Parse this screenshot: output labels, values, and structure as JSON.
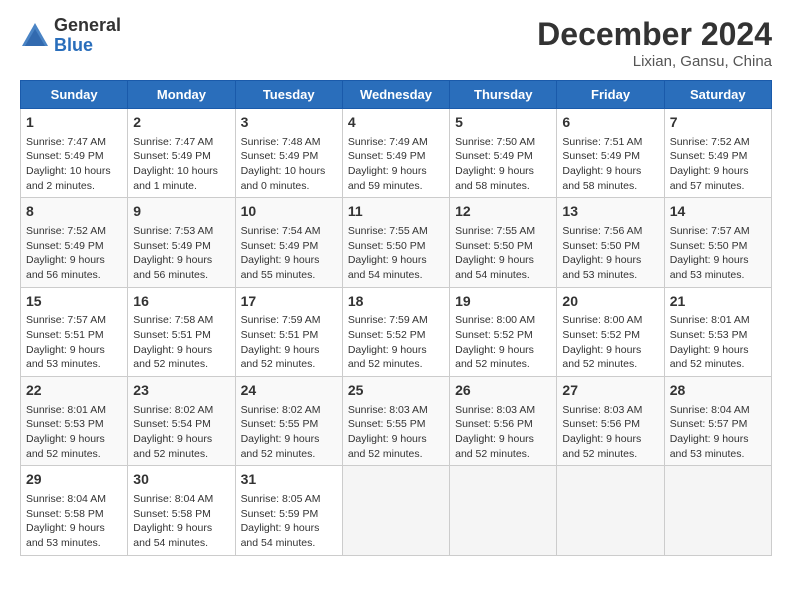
{
  "logo": {
    "general": "General",
    "blue": "Blue"
  },
  "header": {
    "title": "December 2024",
    "subtitle": "Lixian, Gansu, China"
  },
  "columns": [
    "Sunday",
    "Monday",
    "Tuesday",
    "Wednesday",
    "Thursday",
    "Friday",
    "Saturday"
  ],
  "weeks": [
    [
      {
        "day": "1",
        "sunrise": "Sunrise: 7:47 AM",
        "sunset": "Sunset: 5:49 PM",
        "daylight": "Daylight: 10 hours and 2 minutes."
      },
      {
        "day": "2",
        "sunrise": "Sunrise: 7:47 AM",
        "sunset": "Sunset: 5:49 PM",
        "daylight": "Daylight: 10 hours and 1 minute."
      },
      {
        "day": "3",
        "sunrise": "Sunrise: 7:48 AM",
        "sunset": "Sunset: 5:49 PM",
        "daylight": "Daylight: 10 hours and 0 minutes."
      },
      {
        "day": "4",
        "sunrise": "Sunrise: 7:49 AM",
        "sunset": "Sunset: 5:49 PM",
        "daylight": "Daylight: 9 hours and 59 minutes."
      },
      {
        "day": "5",
        "sunrise": "Sunrise: 7:50 AM",
        "sunset": "Sunset: 5:49 PM",
        "daylight": "Daylight: 9 hours and 58 minutes."
      },
      {
        "day": "6",
        "sunrise": "Sunrise: 7:51 AM",
        "sunset": "Sunset: 5:49 PM",
        "daylight": "Daylight: 9 hours and 58 minutes."
      },
      {
        "day": "7",
        "sunrise": "Sunrise: 7:52 AM",
        "sunset": "Sunset: 5:49 PM",
        "daylight": "Daylight: 9 hours and 57 minutes."
      }
    ],
    [
      {
        "day": "8",
        "sunrise": "Sunrise: 7:52 AM",
        "sunset": "Sunset: 5:49 PM",
        "daylight": "Daylight: 9 hours and 56 minutes."
      },
      {
        "day": "9",
        "sunrise": "Sunrise: 7:53 AM",
        "sunset": "Sunset: 5:49 PM",
        "daylight": "Daylight: 9 hours and 56 minutes."
      },
      {
        "day": "10",
        "sunrise": "Sunrise: 7:54 AM",
        "sunset": "Sunset: 5:49 PM",
        "daylight": "Daylight: 9 hours and 55 minutes."
      },
      {
        "day": "11",
        "sunrise": "Sunrise: 7:55 AM",
        "sunset": "Sunset: 5:50 PM",
        "daylight": "Daylight: 9 hours and 54 minutes."
      },
      {
        "day": "12",
        "sunrise": "Sunrise: 7:55 AM",
        "sunset": "Sunset: 5:50 PM",
        "daylight": "Daylight: 9 hours and 54 minutes."
      },
      {
        "day": "13",
        "sunrise": "Sunrise: 7:56 AM",
        "sunset": "Sunset: 5:50 PM",
        "daylight": "Daylight: 9 hours and 53 minutes."
      },
      {
        "day": "14",
        "sunrise": "Sunrise: 7:57 AM",
        "sunset": "Sunset: 5:50 PM",
        "daylight": "Daylight: 9 hours and 53 minutes."
      }
    ],
    [
      {
        "day": "15",
        "sunrise": "Sunrise: 7:57 AM",
        "sunset": "Sunset: 5:51 PM",
        "daylight": "Daylight: 9 hours and 53 minutes."
      },
      {
        "day": "16",
        "sunrise": "Sunrise: 7:58 AM",
        "sunset": "Sunset: 5:51 PM",
        "daylight": "Daylight: 9 hours and 52 minutes."
      },
      {
        "day": "17",
        "sunrise": "Sunrise: 7:59 AM",
        "sunset": "Sunset: 5:51 PM",
        "daylight": "Daylight: 9 hours and 52 minutes."
      },
      {
        "day": "18",
        "sunrise": "Sunrise: 7:59 AM",
        "sunset": "Sunset: 5:52 PM",
        "daylight": "Daylight: 9 hours and 52 minutes."
      },
      {
        "day": "19",
        "sunrise": "Sunrise: 8:00 AM",
        "sunset": "Sunset: 5:52 PM",
        "daylight": "Daylight: 9 hours and 52 minutes."
      },
      {
        "day": "20",
        "sunrise": "Sunrise: 8:00 AM",
        "sunset": "Sunset: 5:52 PM",
        "daylight": "Daylight: 9 hours and 52 minutes."
      },
      {
        "day": "21",
        "sunrise": "Sunrise: 8:01 AM",
        "sunset": "Sunset: 5:53 PM",
        "daylight": "Daylight: 9 hours and 52 minutes."
      }
    ],
    [
      {
        "day": "22",
        "sunrise": "Sunrise: 8:01 AM",
        "sunset": "Sunset: 5:53 PM",
        "daylight": "Daylight: 9 hours and 52 minutes."
      },
      {
        "day": "23",
        "sunrise": "Sunrise: 8:02 AM",
        "sunset": "Sunset: 5:54 PM",
        "daylight": "Daylight: 9 hours and 52 minutes."
      },
      {
        "day": "24",
        "sunrise": "Sunrise: 8:02 AM",
        "sunset": "Sunset: 5:55 PM",
        "daylight": "Daylight: 9 hours and 52 minutes."
      },
      {
        "day": "25",
        "sunrise": "Sunrise: 8:03 AM",
        "sunset": "Sunset: 5:55 PM",
        "daylight": "Daylight: 9 hours and 52 minutes."
      },
      {
        "day": "26",
        "sunrise": "Sunrise: 8:03 AM",
        "sunset": "Sunset: 5:56 PM",
        "daylight": "Daylight: 9 hours and 52 minutes."
      },
      {
        "day": "27",
        "sunrise": "Sunrise: 8:03 AM",
        "sunset": "Sunset: 5:56 PM",
        "daylight": "Daylight: 9 hours and 52 minutes."
      },
      {
        "day": "28",
        "sunrise": "Sunrise: 8:04 AM",
        "sunset": "Sunset: 5:57 PM",
        "daylight": "Daylight: 9 hours and 53 minutes."
      }
    ],
    [
      {
        "day": "29",
        "sunrise": "Sunrise: 8:04 AM",
        "sunset": "Sunset: 5:58 PM",
        "daylight": "Daylight: 9 hours and 53 minutes."
      },
      {
        "day": "30",
        "sunrise": "Sunrise: 8:04 AM",
        "sunset": "Sunset: 5:58 PM",
        "daylight": "Daylight: 9 hours and 54 minutes."
      },
      {
        "day": "31",
        "sunrise": "Sunrise: 8:05 AM",
        "sunset": "Sunset: 5:59 PM",
        "daylight": "Daylight: 9 hours and 54 minutes."
      },
      null,
      null,
      null,
      null
    ]
  ]
}
